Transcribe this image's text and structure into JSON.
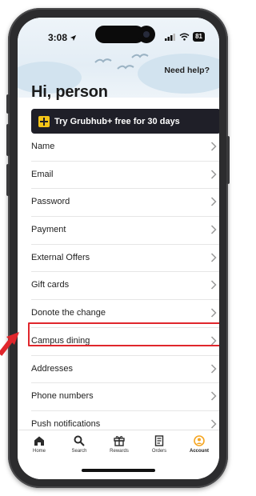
{
  "status_bar": {
    "time": "3:08",
    "battery": "81"
  },
  "header": {
    "help_link": "Need help?",
    "greeting": "Hi, person"
  },
  "promo": {
    "label": "Try Grubhub+ free for 30 days"
  },
  "menu": {
    "items": [
      {
        "label": "Name"
      },
      {
        "label": "Email"
      },
      {
        "label": "Password"
      },
      {
        "label": "Payment"
      },
      {
        "label": "External Offers"
      },
      {
        "label": "Gift cards"
      },
      {
        "label": "Donote the change"
      },
      {
        "label": "Campus dining"
      },
      {
        "label": "Addresses"
      },
      {
        "label": "Phone numbers"
      },
      {
        "label": "Push notifications"
      }
    ]
  },
  "tabs": [
    {
      "label": "Home",
      "icon": "home-icon"
    },
    {
      "label": "Search",
      "icon": "search-icon"
    },
    {
      "label": "Rewards",
      "icon": "gift-icon"
    },
    {
      "label": "Orders",
      "icon": "receipt-icon"
    },
    {
      "label": "Account",
      "icon": "account-icon",
      "active": true
    }
  ],
  "colors": {
    "accent": "#f5a623",
    "highlight_box": "#e0262c",
    "promo_bg": "#1f1f28",
    "promo_icon": "#f5c518"
  }
}
